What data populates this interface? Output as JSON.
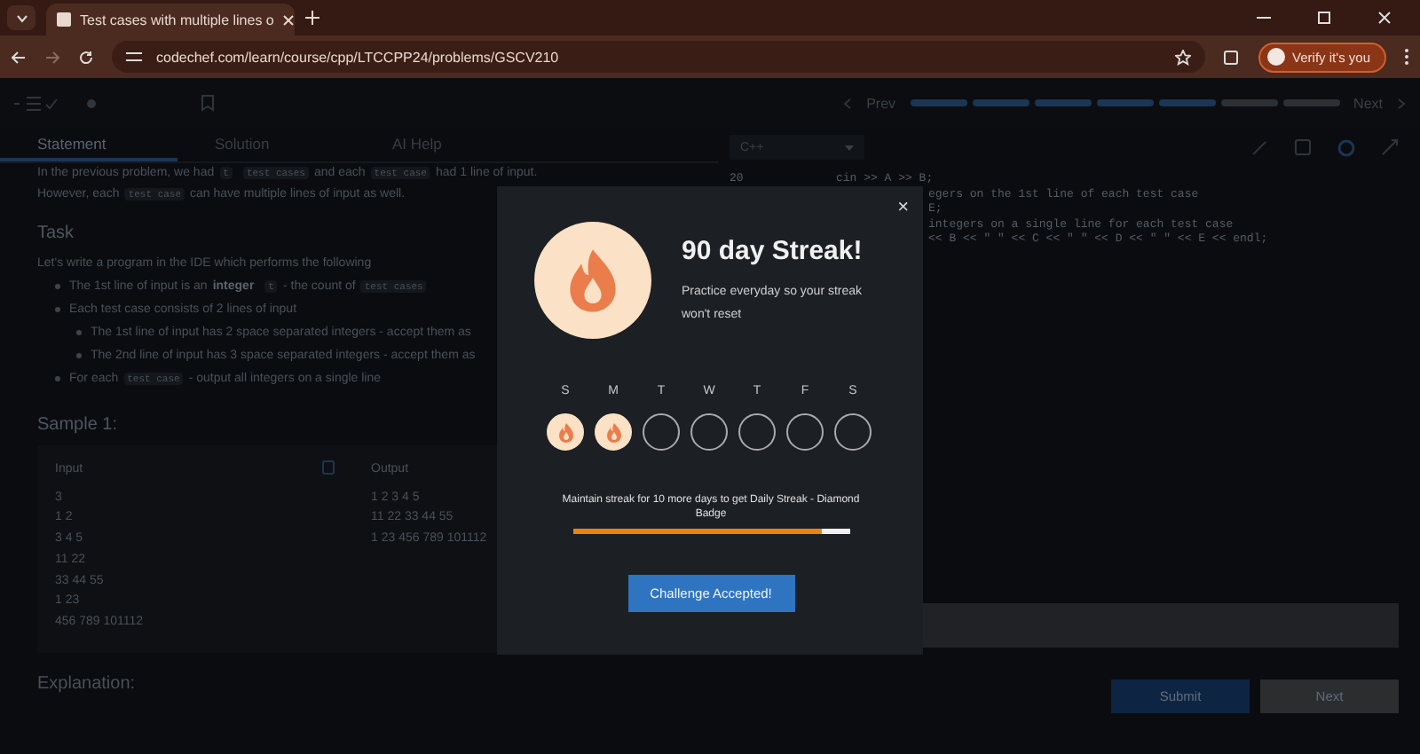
{
  "browser": {
    "tab_title": "Test cases with multiple lines o",
    "url": "codechef.com/learn/course/cpp/LTCCPP24/problems/GSCV210",
    "profile_button": "Verify it's you"
  },
  "toolbar": {
    "prev": "Prev",
    "next": "Next",
    "progress": [
      {
        "done": true
      },
      {
        "done": true
      },
      {
        "done": true
      },
      {
        "done": true
      },
      {
        "done": true
      },
      {
        "done": false
      },
      {
        "done": false
      }
    ]
  },
  "tabs": [
    {
      "label": "Statement",
      "selected": true
    },
    {
      "label": "Solution",
      "selected": false
    },
    {
      "label": "AI Help",
      "selected": false
    }
  ],
  "statement": {
    "intro": [
      [
        {
          "kind": "text",
          "text": "In the previous problem, we had"
        },
        {
          "kind": "code",
          "text": "t"
        },
        {
          "kind": "code",
          "text": "test cases"
        },
        {
          "kind": "text",
          "text": "and each"
        },
        {
          "kind": "code",
          "text": "test case"
        },
        {
          "kind": "text",
          "text": "had 1 line of input."
        }
      ],
      [
        {
          "kind": "text",
          "text": "However, each"
        },
        {
          "kind": "code",
          "text": "test case"
        },
        {
          "kind": "text",
          "text": "can have multiple lines of input as well."
        }
      ]
    ],
    "task_heading": "Task",
    "task_intro": "Let's write a program in the IDE which performs the following",
    "bullets": [
      {
        "segments": [
          {
            "kind": "text",
            "text": "The 1st line of input is an"
          },
          {
            "kind": "bold",
            "text": "integer"
          },
          {
            "kind": "code",
            "text": "t"
          },
          {
            "kind": "text",
            "text": "- the count of"
          },
          {
            "kind": "code",
            "text": "test cases"
          }
        ]
      },
      {
        "segments": [
          {
            "kind": "text",
            "text": "Each test case consists of 2 lines of input"
          }
        ],
        "children": [
          [
            {
              "kind": "text",
              "text": "The 1st line of input has 2 space separated integers - accept them as"
            }
          ],
          [
            {
              "kind": "text",
              "text": "The 2nd line of input has 3 space separated integers - accept them as"
            }
          ]
        ]
      },
      {
        "segments": [
          {
            "kind": "text",
            "text": "For each"
          },
          {
            "kind": "code",
            "text": "test case"
          },
          {
            "kind": "text",
            "text": "- output all integers on a single line"
          }
        ]
      }
    ]
  },
  "sample": {
    "heading": "Sample 1:",
    "input_label": "Input",
    "output_label": "Output",
    "input_lines": [
      "3",
      "1 2",
      "3 4 5",
      "11 22",
      "33 44 55",
      "1 23",
      "456 789 101112"
    ],
    "output_lines": [
      "1 2 3 4 5",
      "11 22 33 44 55",
      "1 23 456 789 101112"
    ]
  },
  "explanation_heading": "Explanation:",
  "editor": {
    "language": "C++",
    "lines": [
      {
        "number": "20",
        "code": "cin >> A >> B;"
      },
      {
        "code": "egers on the 1st line of each test case"
      },
      {
        "code": "E;"
      },
      {
        "code": "integers on a single line for each test case"
      },
      {
        "code": "<< B << \" \" << C << \" \" << D << \" \" << E << endl;"
      }
    ]
  },
  "buttons": [
    {
      "label": "Submit",
      "kind": "primary"
    },
    {
      "label": "Next",
      "kind": "secondary"
    }
  ],
  "modal": {
    "close": "×",
    "title": "90 day Streak!",
    "subtitle": "Practice everyday so your streak won't reset",
    "days": [
      {
        "label": "S",
        "done": true
      },
      {
        "label": "M",
        "done": true
      },
      {
        "label": "T",
        "done": false
      },
      {
        "label": "W",
        "done": false
      },
      {
        "label": "T",
        "done": false
      },
      {
        "label": "F",
        "done": false
      },
      {
        "label": "S",
        "done": false
      }
    ],
    "goal": "Maintain streak for 10 more days to get Daily Streak - Diamond Badge",
    "level": 0.9,
    "button": "Challenge Accepted!"
  }
}
